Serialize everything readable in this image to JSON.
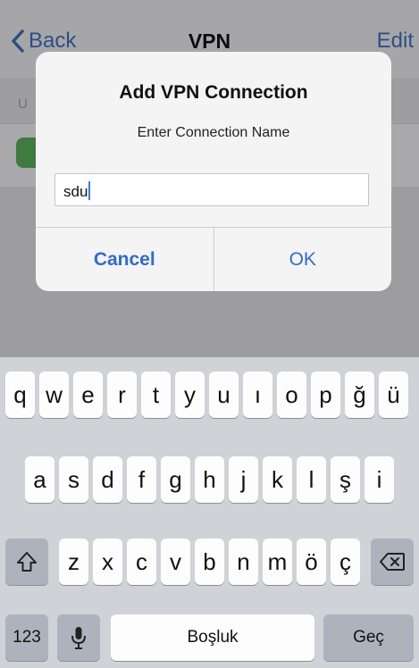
{
  "navbar": {
    "back_label": "Back",
    "title": "VPN",
    "edit_label": "Edit"
  },
  "section": {
    "header_letter": "U"
  },
  "alert": {
    "title": "Add VPN Connection",
    "message": "Enter Connection Name",
    "input_value": "sdu",
    "cancel_label": "Cancel",
    "ok_label": "OK"
  },
  "keyboard": {
    "row1": [
      "q",
      "w",
      "e",
      "r",
      "t",
      "y",
      "u",
      "ı",
      "o",
      "p",
      "ğ",
      "ü"
    ],
    "row2": [
      "a",
      "s",
      "d",
      "f",
      "g",
      "h",
      "j",
      "k",
      "l",
      "ş",
      "i"
    ],
    "row3": [
      "z",
      "x",
      "c",
      "v",
      "b",
      "n",
      "m",
      "ö",
      "ç"
    ],
    "numbers_label": "123",
    "space_label": "Boşluk",
    "return_label": "Geç"
  },
  "icons": {
    "back": "chevron-left-icon",
    "shift": "shift-icon",
    "delete": "delete-icon",
    "mic": "microphone-icon"
  },
  "colors": {
    "accent": "#2f6bd4",
    "keyboard_bg": "#cfd2d7"
  }
}
